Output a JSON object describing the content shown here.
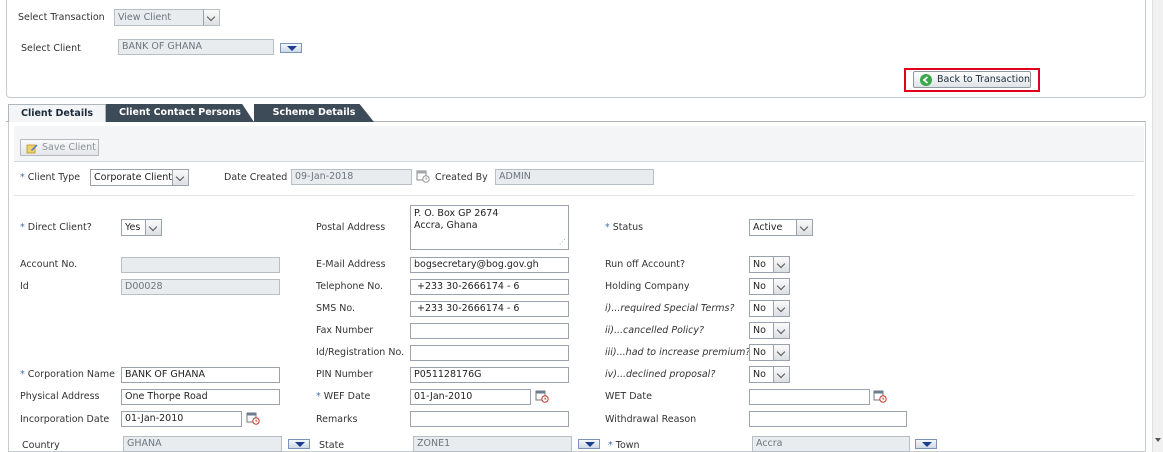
{
  "header": {
    "select_transaction_label": "Select Transaction",
    "select_transaction_value": "View Client",
    "select_client_label": "Select Client",
    "select_client_value": "BANK OF GHANA",
    "back_button_label": "Back to Transaction"
  },
  "tabs": [
    {
      "label": "Client Details",
      "active": true
    },
    {
      "label": "Client Contact Persons",
      "active": false
    },
    {
      "label": "Scheme Details",
      "active": false
    }
  ],
  "toolbar": {
    "save_label": "Save Client"
  },
  "row1": {
    "client_type_label": "Client Type",
    "client_type_value": "Corporate Client",
    "date_created_label": "Date Created",
    "date_created_value": "09-Jan-2018",
    "created_by_label": "Created By",
    "created_by_value": "ADMIN"
  },
  "left": {
    "direct_client_label": "Direct Client?",
    "direct_client_value": "Yes",
    "account_no_label": "Account No.",
    "account_no_value": "",
    "id_label": "Id",
    "id_value": "D00028",
    "corporation_name_label": "Corporation Name",
    "corporation_name_value": "BANK OF GHANA",
    "physical_address_label": "Physical Address",
    "physical_address_value": "One Thorpe Road",
    "incorporation_date_label": "Incorporation Date",
    "incorporation_date_value": "01-Jan-2010",
    "country_label": "Country",
    "country_value": "GHANA"
  },
  "middle": {
    "postal_address_label": "Postal Address",
    "postal_address_line1": "P. O. Box GP 2674",
    "postal_address_line2": "Accra, Ghana",
    "email_label": "E-Mail Address",
    "email_value": "bogsecretary@bog.gov.gh",
    "telephone_label": "Telephone No.",
    "telephone_value": "+233 30-2666174 - 6",
    "sms_label": "SMS No.",
    "sms_value": "+233 30-2666174 - 6",
    "fax_label": "Fax Number",
    "fax_value": "",
    "id_reg_label": "Id/Registration No.",
    "id_reg_value": "",
    "pin_label": "PIN Number",
    "pin_value": "P051128176G",
    "wef_date_label": "WEF Date",
    "wef_date_value": "01-Jan-2010",
    "remarks_label": "Remarks",
    "remarks_value": "",
    "state_label": "State",
    "state_value": "ZONE1"
  },
  "right": {
    "status_label": "Status",
    "status_value": "Active",
    "run_off_label": "Run off Account?",
    "run_off_value": "No",
    "holding_label": "Holding Company",
    "holding_value": "No",
    "special_terms_label": "i)...required Special Terms?",
    "special_terms_value": "No",
    "cancelled_label": "ii)...cancelled Policy?",
    "cancelled_value": "No",
    "increase_premium_label": "iii)...had to increase premium?",
    "increase_premium_value": "No",
    "declined_label": "iv)...declined proposal?",
    "declined_value": "No",
    "wet_date_label": "WET Date",
    "wet_date_value": "",
    "withdrawal_label": "Withdrawal Reason",
    "withdrawal_value": "",
    "town_label": "Town",
    "town_value": "Accra"
  },
  "required_marker": "*",
  "colors": {
    "highlight_border": "#e0001b",
    "tab_dark": "#3d4a57",
    "required_star": "#3a6fb7"
  }
}
